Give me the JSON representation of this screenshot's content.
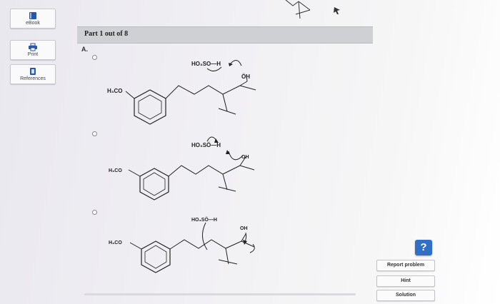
{
  "sidebar": {
    "items": [
      {
        "label": "eBook",
        "icon": "book-icon"
      },
      {
        "label": "Print",
        "icon": "printer-icon"
      },
      {
        "label": "References",
        "icon": "references-icon"
      }
    ]
  },
  "part": {
    "title": "Part 1 out of 8"
  },
  "question": {
    "label": "A."
  },
  "structures": {
    "opt1": {
      "reagent": "HO₃SO—H",
      "oh": "ÖH",
      "methoxy": "H₃CO"
    },
    "opt2": {
      "reagent": "HO₃SÖ—H",
      "oh": "OH",
      "methoxy": "H₃CO"
    },
    "opt3": {
      "reagent": "HO₃SÖ—H",
      "oh": "OH",
      "methoxy": "H₃CO"
    }
  },
  "help": {
    "label": "?"
  },
  "buttons": {
    "report": "Report problem",
    "hint": "Hint",
    "solution": "Solution"
  },
  "colors": {
    "help_blue": "#2f6fc4",
    "part_bar": "#cfd0d4"
  }
}
